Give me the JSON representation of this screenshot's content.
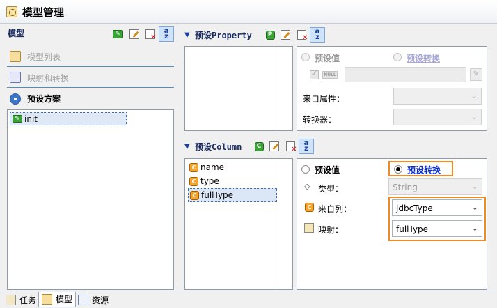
{
  "window": {
    "title": "模型管理"
  },
  "left": {
    "header": "模型",
    "nav": [
      {
        "label": "模型列表",
        "active": false
      },
      {
        "label": "映射和转换",
        "active": false
      },
      {
        "label": "预设方案",
        "active": true
      }
    ],
    "schemes": [
      "init"
    ]
  },
  "property": {
    "title": "预设Property",
    "preset_value_label": "预设值",
    "preset_convert_label": "预设转换",
    "null_label": "NULL",
    "from_attr_label": "来自属性：",
    "converter_label": "转换器："
  },
  "column": {
    "title": "预设Column",
    "items": [
      "name",
      "type",
      "fullType"
    ],
    "selected": "fullType",
    "preset_value_label": "预设值",
    "preset_convert_label": "预设转换",
    "type_label": "类型：",
    "type_value": "String",
    "from_column_label": "来自列：",
    "from_column_value": "jdbcType",
    "mapping_label": "映射：",
    "mapping_value": "fullType"
  },
  "bottom_tabs": [
    {
      "label": "任务",
      "selected": false
    },
    {
      "label": "模型",
      "selected": true
    },
    {
      "label": "资源",
      "selected": false
    }
  ]
}
